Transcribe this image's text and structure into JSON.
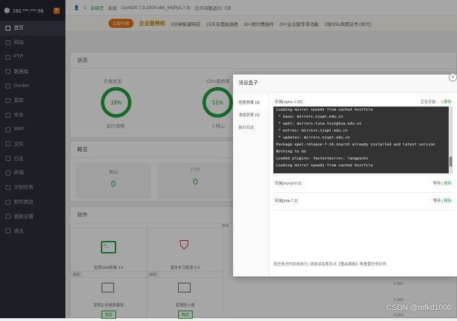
{
  "server": {
    "ip": "192.***.***.56",
    "notify_count": "3"
  },
  "sidebar": {
    "items": [
      {
        "label": "首页",
        "active": true,
        "icon": "home-icon"
      },
      {
        "label": "网站",
        "icon": "globe-icon"
      },
      {
        "label": "FTP",
        "icon": "ftp-icon"
      },
      {
        "label": "数据库",
        "icon": "database-icon"
      },
      {
        "label": "Docker",
        "icon": "docker-icon"
      },
      {
        "label": "监控",
        "icon": "monitor-icon"
      },
      {
        "label": "安全",
        "icon": "shield-icon"
      },
      {
        "label": "WAF",
        "icon": "waf-icon"
      },
      {
        "label": "文件",
        "icon": "folder-icon"
      },
      {
        "label": "日志",
        "icon": "log-icon"
      },
      {
        "label": "终端",
        "icon": "terminal-icon"
      },
      {
        "label": "计划任务",
        "icon": "clock-icon"
      },
      {
        "label": "软件商店",
        "icon": "store-icon"
      },
      {
        "label": "面板设置",
        "icon": "gear-icon"
      },
      {
        "label": "退出",
        "icon": "logout-icon"
      }
    ]
  },
  "topbar": {
    "user": "1",
    "bound": "未绑定",
    "system_label": "系统",
    "system": "CentOS 7.9.2009 x86_64(Py3.7.9)",
    "uptime": "已不间断运行: 0天"
  },
  "promo": {
    "buy": "立即升级",
    "enterprise": "企业版特权",
    "items": [
      "5分钟极速响应",
      "15天无理由退款",
      "30+款付费插件",
      "20+企业版专享功能",
      "2张SSL商用证书 (年付)"
    ]
  },
  "status_panel": {
    "title": "状态",
    "load_label": "负载状态",
    "load_value": "18%",
    "load_sub": "运行流畅",
    "cpu_label": "CPU使用率",
    "cpu_value": "51%",
    "cpu_sub": "2 核心"
  },
  "overview_panel": {
    "title": "概览",
    "site_label": "网站",
    "site_value": "0",
    "ftp_label": "FTP",
    "ftp_value": "0"
  },
  "software_panel": {
    "title": "软件",
    "cards": [
      {
        "name": "宝塔SSH终端 1.0",
        "tag": ""
      },
      {
        "name": "堡垒木马检测 1.0",
        "tag": ""
      },
      {
        "name": "宝塔企业级防篡改",
        "tag": "推荐",
        "buy": "购买"
      },
      {
        "name": "宝塔防入侵",
        "tag": "推荐",
        "buy": "购买"
      }
    ],
    "recommend_tag": "推荐"
  },
  "dialog": {
    "title": "消息盒子",
    "nav": [
      {
        "label": "任务列表 (3)",
        "active": true
      },
      {
        "label": "消息列表 (0)"
      },
      {
        "label": "执行日志"
      }
    ],
    "tasks": [
      {
        "name": "安装[nginx-1.22]",
        "status": "正在安装 ··· ",
        "delete": "删除"
      },
      {
        "name": "安装[mysql-5.5]",
        "status": "等待",
        "delete": "删除"
      },
      {
        "name": "安装[php-7.3]",
        "status": "等待",
        "delete": "删除"
      }
    ],
    "console_lines": [
      "Loading mirror speeds from cached hostfile",
      " * base: mirrors.njupt.edu.cn",
      " * epel: mirrors.tuna.tsinghua.edu.cn",
      " * extras: mirrors.njupt.edu.cn",
      " * updates: mirrors.njupt.edu.cn",
      "Package epel-release-7-14.noarch already installed and latest version",
      "Nothing to do",
      "Loaded plugins: fastestmirror, langpacks",
      "Loading mirror speeds from cached hostfile"
    ],
    "footer_note": "若任务长时间未执行, 请尝试在首页点【重启面板】来重置任务队列",
    "close": "×"
  },
  "chart_ticks": [
    "6,000",
    "5,000",
    "4,000"
  ],
  "watermark": "CSDN @mfkd1000"
}
